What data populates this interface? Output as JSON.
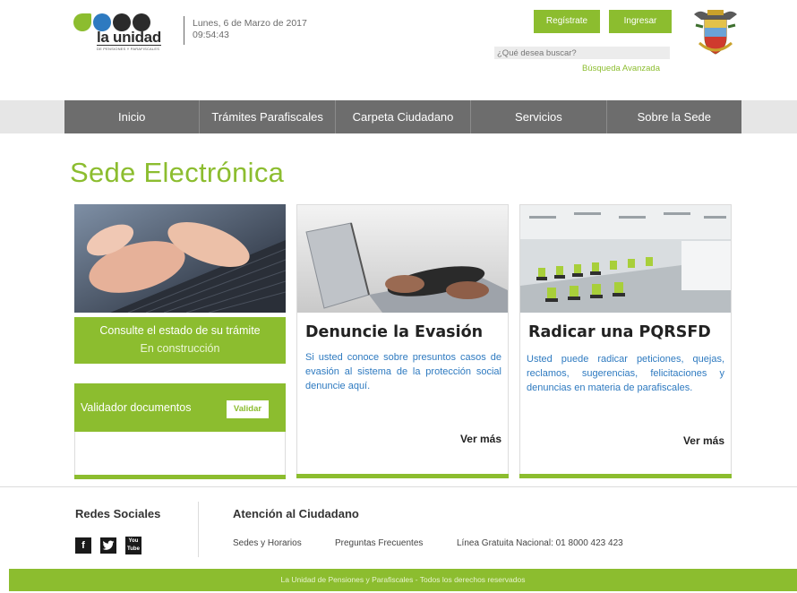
{
  "header": {
    "logo_text": "la unidad",
    "logo_subtext": "DE PENSIONES Y PARAFISCALES",
    "date": "Lunes, 6 de Marzo de 2017",
    "time": "09:54:43",
    "register_label": "Regístrate",
    "login_label": "Ingresar",
    "search_placeholder": "¿Qué desea buscar?",
    "advanced_search": "Búsqueda Avanzada"
  },
  "nav": {
    "items": [
      "Inicio",
      "Trámites Parafiscales",
      "Carpeta Ciudadano",
      "Servicios",
      "Sobre la Sede"
    ]
  },
  "page_title": "Sede Electrónica",
  "cards": {
    "status": {
      "consult_text": "Consulte el estado de su trámite",
      "construction_text": "En construcción",
      "validator_label": "Validador documentos",
      "validate_button": "Validar"
    },
    "evasion": {
      "title": "Denuncie la Evasión",
      "text": "Si usted conoce sobre presuntos casos de evasión al sistema de la protección social denuncie aquí.",
      "more": "Ver más"
    },
    "pqrsfd": {
      "title": "Radicar una PQRSFD",
      "text": "Usted puede radicar peticiones, quejas, reclamos, sugerencias, felicitaciones y denuncias en materia de parafiscales.",
      "more": "Ver más"
    }
  },
  "footer": {
    "social_title": "Redes Sociales",
    "social_icons": [
      "facebook-icon",
      "twitter-icon",
      "youtube-icon"
    ],
    "facebook_glyph": "f",
    "twitter_glyph": "t",
    "youtube_glyph": "You Tube",
    "attention_title": "Atención al Ciudadano",
    "links": [
      "Sedes y Horarios",
      "Preguntas Frecuentes",
      "Línea Gratuita Nacional: 01 8000 423 423"
    ],
    "copyright": "La Unidad de Pensiones y Parafiscales - Todos los derechos reservados"
  },
  "colors": {
    "accent": "#8cbd2f",
    "nav_bg": "#6d6d6d",
    "title_blue": "#2e7ac0"
  }
}
